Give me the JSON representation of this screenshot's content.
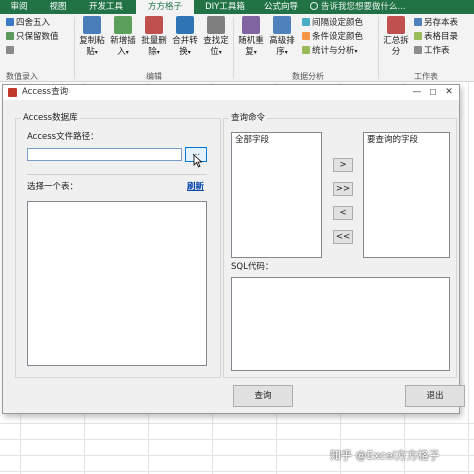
{
  "ribbon": {
    "tabs": [
      "审阅",
      "视图",
      "开发工具",
      "方方格子",
      "DIY工具箱",
      "公式向导"
    ],
    "active_tab": "方方格子",
    "tell_me": "告诉我您想要做什么...",
    "left_items": [
      "四舍五入",
      "只保留数值",
      ""
    ],
    "left_group": "数值录入",
    "buttons_edit": [
      {
        "l1": "复制粘",
        "l2": "贴",
        "arrow": "▾"
      },
      {
        "l1": "新增插",
        "l2": "入",
        "arrow": "▾"
      },
      {
        "l1": "批量删",
        "l2": "除",
        "arrow": "▾"
      },
      {
        "l1": "合并转",
        "l2": "换",
        "arrow": "▾"
      },
      {
        "l1": "查找定",
        "l2": "位",
        "arrow": "▾"
      }
    ],
    "edit_group": "编辑",
    "buttons_analysis": [
      {
        "l1": "随机重",
        "l2": "复",
        "arrow": "▾"
      },
      {
        "l1": "高级排",
        "l2": "序",
        "arrow": "▾"
      }
    ],
    "analysis_items": [
      "间隔设定颜色",
      "条件设定颜色",
      "统计与分析"
    ],
    "analysis_group": "数据分析",
    "worksheet_button": {
      "l1": "汇总拆",
      "l2": "分"
    },
    "worksheet_items": [
      "另存本表",
      "表格目录",
      "工作表"
    ],
    "worksheet_group": "工作表"
  },
  "colors": {
    "excel_green": "#217346",
    "link_blue": "#0645ad",
    "focus_blue": "#0078d7"
  },
  "dialog": {
    "title": "Access查询",
    "minimize": "—",
    "maximize": "☐",
    "close": "✕",
    "db_group": "Access数据库",
    "path_label": "Access文件路径：",
    "path_value": "",
    "browse": "...",
    "table_label": "选择一个表：",
    "refresh": "刷新",
    "query_group": "查询命令",
    "all_fields": "全部字段",
    "selected_fields": "要查询的字段",
    "move_right": ">",
    "move_all_right": ">>",
    "move_left": "<",
    "move_all_left": "<<",
    "sql_label": "SQL代码：",
    "query_button": "查询",
    "exit_button": "退出"
  },
  "watermark": "知乎 @Excel方方格子"
}
